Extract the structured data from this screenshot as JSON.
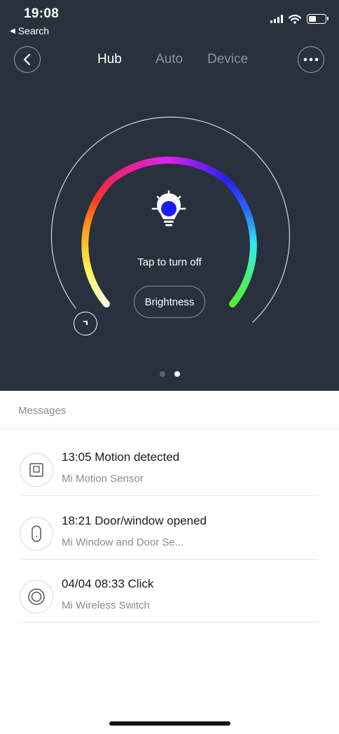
{
  "status_bar": {
    "time": "19:08",
    "back_label": "Search"
  },
  "nav": {
    "tabs": [
      {
        "label": "Hub",
        "active": true
      },
      {
        "label": "Auto",
        "active": false
      },
      {
        "label": "Device",
        "active": false
      }
    ]
  },
  "light": {
    "action_text": "Tap to turn off",
    "brightness_label": "Brightness",
    "bulb_color": "#1a1aff",
    "page_index": 2,
    "page_count": 2
  },
  "messages": {
    "header": "Messages",
    "items": [
      {
        "title": "13:05 Motion detected",
        "subtitle": "Mi Motion Sensor",
        "icon": "motion-sensor-icon"
      },
      {
        "title": "18:21 Door/window opened",
        "subtitle": "Mi Window and Door Se...",
        "icon": "door-sensor-icon"
      },
      {
        "title": "04/04 08:33 Click",
        "subtitle": "Mi Wireless Switch",
        "icon": "wireless-switch-icon"
      }
    ]
  },
  "colors": {
    "panel_bg": "#28313d",
    "text_muted": "#8c8c8c"
  }
}
